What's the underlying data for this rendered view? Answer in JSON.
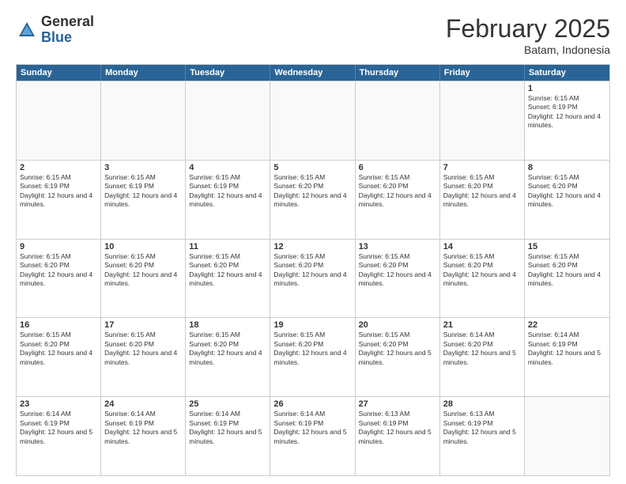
{
  "header": {
    "logo": {
      "general": "General",
      "blue": "Blue"
    },
    "title": "February 2025",
    "subtitle": "Batam, Indonesia"
  },
  "calendar": {
    "days": [
      "Sunday",
      "Monday",
      "Tuesday",
      "Wednesday",
      "Thursday",
      "Friday",
      "Saturday"
    ],
    "rows": [
      [
        {
          "day": "",
          "empty": true
        },
        {
          "day": "",
          "empty": true
        },
        {
          "day": "",
          "empty": true
        },
        {
          "day": "",
          "empty": true
        },
        {
          "day": "",
          "empty": true
        },
        {
          "day": "",
          "empty": true
        },
        {
          "day": "1",
          "sunrise": "Sunrise: 6:15 AM",
          "sunset": "Sunset: 6:19 PM",
          "daylight": "Daylight: 12 hours and 4 minutes."
        }
      ],
      [
        {
          "day": "2",
          "sunrise": "Sunrise: 6:15 AM",
          "sunset": "Sunset: 6:19 PM",
          "daylight": "Daylight: 12 hours and 4 minutes."
        },
        {
          "day": "3",
          "sunrise": "Sunrise: 6:15 AM",
          "sunset": "Sunset: 6:19 PM",
          "daylight": "Daylight: 12 hours and 4 minutes."
        },
        {
          "day": "4",
          "sunrise": "Sunrise: 6:15 AM",
          "sunset": "Sunset: 6:19 PM",
          "daylight": "Daylight: 12 hours and 4 minutes."
        },
        {
          "day": "5",
          "sunrise": "Sunrise: 6:15 AM",
          "sunset": "Sunset: 6:20 PM",
          "daylight": "Daylight: 12 hours and 4 minutes."
        },
        {
          "day": "6",
          "sunrise": "Sunrise: 6:15 AM",
          "sunset": "Sunset: 6:20 PM",
          "daylight": "Daylight: 12 hours and 4 minutes."
        },
        {
          "day": "7",
          "sunrise": "Sunrise: 6:15 AM",
          "sunset": "Sunset: 6:20 PM",
          "daylight": "Daylight: 12 hours and 4 minutes."
        },
        {
          "day": "8",
          "sunrise": "Sunrise: 6:15 AM",
          "sunset": "Sunset: 6:20 PM",
          "daylight": "Daylight: 12 hours and 4 minutes."
        }
      ],
      [
        {
          "day": "9",
          "sunrise": "Sunrise: 6:15 AM",
          "sunset": "Sunset: 6:20 PM",
          "daylight": "Daylight: 12 hours and 4 minutes."
        },
        {
          "day": "10",
          "sunrise": "Sunrise: 6:15 AM",
          "sunset": "Sunset: 6:20 PM",
          "daylight": "Daylight: 12 hours and 4 minutes."
        },
        {
          "day": "11",
          "sunrise": "Sunrise: 6:15 AM",
          "sunset": "Sunset: 6:20 PM",
          "daylight": "Daylight: 12 hours and 4 minutes."
        },
        {
          "day": "12",
          "sunrise": "Sunrise: 6:15 AM",
          "sunset": "Sunset: 6:20 PM",
          "daylight": "Daylight: 12 hours and 4 minutes."
        },
        {
          "day": "13",
          "sunrise": "Sunrise: 6:15 AM",
          "sunset": "Sunset: 6:20 PM",
          "daylight": "Daylight: 12 hours and 4 minutes."
        },
        {
          "day": "14",
          "sunrise": "Sunrise: 6:15 AM",
          "sunset": "Sunset: 6:20 PM",
          "daylight": "Daylight: 12 hours and 4 minutes."
        },
        {
          "day": "15",
          "sunrise": "Sunrise: 6:15 AM",
          "sunset": "Sunset: 6:20 PM",
          "daylight": "Daylight: 12 hours and 4 minutes."
        }
      ],
      [
        {
          "day": "16",
          "sunrise": "Sunrise: 6:15 AM",
          "sunset": "Sunset: 6:20 PM",
          "daylight": "Daylight: 12 hours and 4 minutes."
        },
        {
          "day": "17",
          "sunrise": "Sunrise: 6:15 AM",
          "sunset": "Sunset: 6:20 PM",
          "daylight": "Daylight: 12 hours and 4 minutes."
        },
        {
          "day": "18",
          "sunrise": "Sunrise: 6:15 AM",
          "sunset": "Sunset: 6:20 PM",
          "daylight": "Daylight: 12 hours and 4 minutes."
        },
        {
          "day": "19",
          "sunrise": "Sunrise: 6:15 AM",
          "sunset": "Sunset: 6:20 PM",
          "daylight": "Daylight: 12 hours and 4 minutes."
        },
        {
          "day": "20",
          "sunrise": "Sunrise: 6:15 AM",
          "sunset": "Sunset: 6:20 PM",
          "daylight": "Daylight: 12 hours and 5 minutes."
        },
        {
          "day": "21",
          "sunrise": "Sunrise: 6:14 AM",
          "sunset": "Sunset: 6:20 PM",
          "daylight": "Daylight: 12 hours and 5 minutes."
        },
        {
          "day": "22",
          "sunrise": "Sunrise: 6:14 AM",
          "sunset": "Sunset: 6:19 PM",
          "daylight": "Daylight: 12 hours and 5 minutes."
        }
      ],
      [
        {
          "day": "23",
          "sunrise": "Sunrise: 6:14 AM",
          "sunset": "Sunset: 6:19 PM",
          "daylight": "Daylight: 12 hours and 5 minutes."
        },
        {
          "day": "24",
          "sunrise": "Sunrise: 6:14 AM",
          "sunset": "Sunset: 6:19 PM",
          "daylight": "Daylight: 12 hours and 5 minutes."
        },
        {
          "day": "25",
          "sunrise": "Sunrise: 6:14 AM",
          "sunset": "Sunset: 6:19 PM",
          "daylight": "Daylight: 12 hours and 5 minutes."
        },
        {
          "day": "26",
          "sunrise": "Sunrise: 6:14 AM",
          "sunset": "Sunset: 6:19 PM",
          "daylight": "Daylight: 12 hours and 5 minutes."
        },
        {
          "day": "27",
          "sunrise": "Sunrise: 6:13 AM",
          "sunset": "Sunset: 6:19 PM",
          "daylight": "Daylight: 12 hours and 5 minutes."
        },
        {
          "day": "28",
          "sunrise": "Sunrise: 6:13 AM",
          "sunset": "Sunset: 6:19 PM",
          "daylight": "Daylight: 12 hours and 5 minutes."
        },
        {
          "day": "",
          "empty": true
        }
      ]
    ]
  }
}
